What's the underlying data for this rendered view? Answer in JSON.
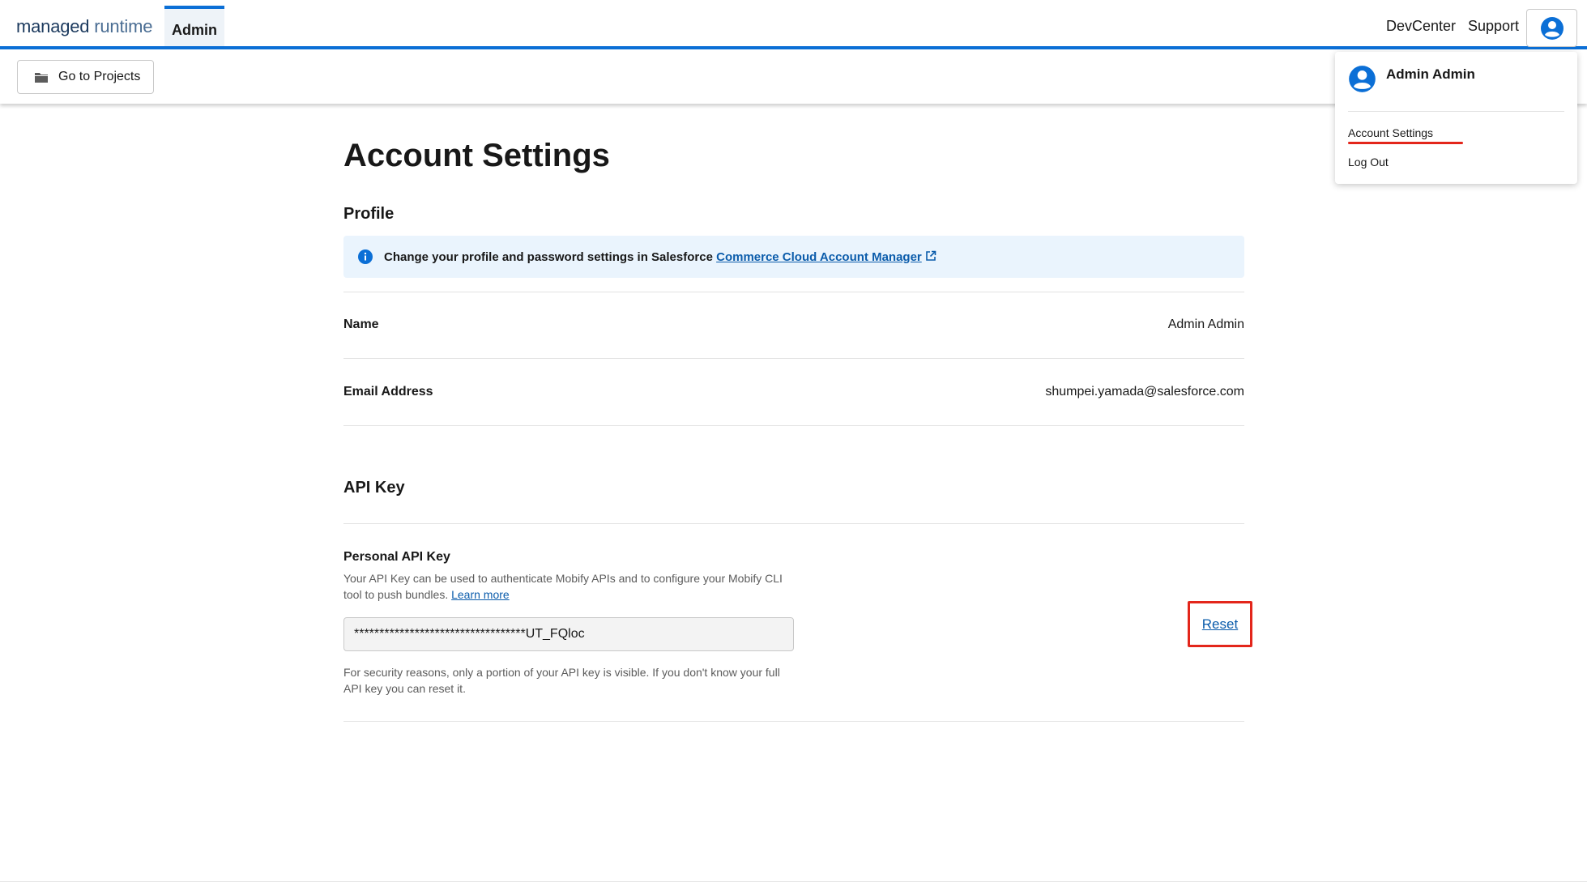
{
  "header": {
    "logo_main": "managed",
    "logo_light": "runtime",
    "admin_tab": "Admin",
    "devcenter": "DevCenter",
    "support": "Support",
    "user_icon": "user-circle-icon"
  },
  "subbar": {
    "projects_button": "Go to Projects",
    "projects_icon": "folder-icon"
  },
  "dropdown": {
    "user_name": "Admin Admin",
    "account_settings": "Account Settings",
    "log_out": "Log Out"
  },
  "main": {
    "title": "Account Settings",
    "profile": {
      "heading": "Profile",
      "info_text": "Change your profile and password settings in Salesforce",
      "info_link": "Commerce Cloud Account Manager",
      "name_label": "Name",
      "name_value": "Admin Admin",
      "email_label": "Email Address",
      "email_value": "shumpei.yamada@salesforce.com"
    },
    "api_key": {
      "heading": "API Key",
      "label": "Personal API Key",
      "description": "Your API Key can be used to authenticate Mobify APIs and to configure your Mobify CLI tool to push bundles.",
      "learn_more": "Learn more",
      "value": "**********************************UT_FQloc",
      "note": "For security reasons, only a portion of your API key is visible. If you don't know your full API key you can reset it.",
      "reset": "Reset"
    }
  },
  "colors": {
    "accent": "#0b6fd6",
    "link": "#0b5cab",
    "highlight": "#e3261b",
    "info_bg": "#eaf4fd"
  }
}
